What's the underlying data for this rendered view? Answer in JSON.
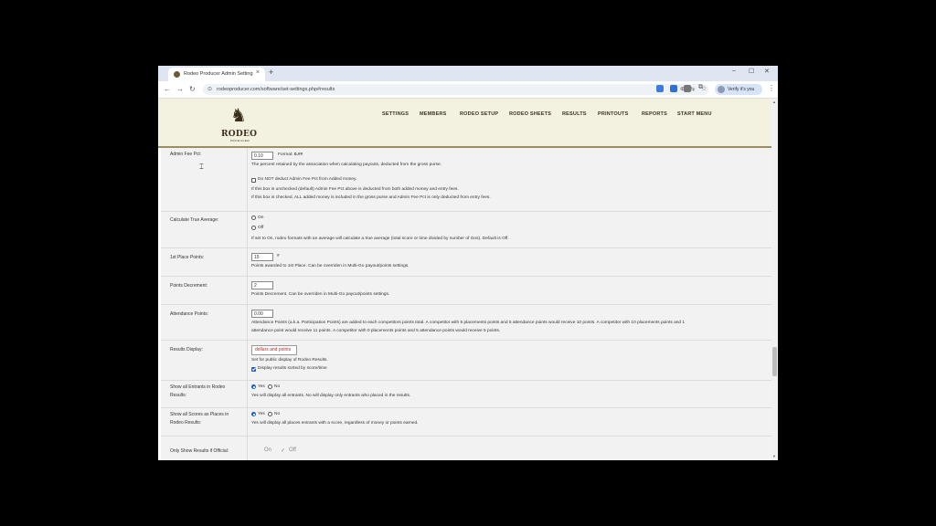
{
  "browser": {
    "tab_title": "Rodeo Producer Admin Setting",
    "url": "rodeoproducer.com/software/set-settings.php#results",
    "verify_label": "Verify it's you",
    "icons": [
      "back-icon",
      "forward-icon",
      "reload-icon",
      "zoom-icon",
      "translate-icon",
      "star-icon",
      "extensions-icon",
      "menu-icon"
    ]
  },
  "site": {
    "logo_text": "RODEO",
    "logo_sub": "PRODUCER",
    "nav": [
      "SETTINGS",
      "MEMBERS",
      "RODEO SETUP",
      "RODEO SHEETS",
      "RESULTS",
      "PRINTOUTS",
      "REPORTS",
      "START MENU"
    ]
  },
  "settings": {
    "admin_fee": {
      "label": "Admin Fee Pct:",
      "value": "0.10",
      "format_label": "Format:",
      "format_value": "0.##",
      "desc": "The percent retained by the association when calculating payouts, deducted from the gross purse.",
      "checkbox_label": "Do NOT deduct Admin Fee Pct from Added money.",
      "note1": "If this box is unchecked (default) Admin Fee Pct above is deducted from both added money and entry fees.",
      "note2": "If this box is checked, ALL added money is included in the gross purse and Admin Fee Pct is only deducted from entry fees."
    },
    "true_average": {
      "label": "Calculate True Average:",
      "on": "On",
      "off": "Off",
      "desc": "If set to On, rodeo formats with an average will calculate a true average (total score or time divided by number of Gos). Default is Off."
    },
    "first_place": {
      "label": "1st Place Points:",
      "value": "15",
      "suffix": "#",
      "desc": "Points awarded to 1st Place. Can be overriden in Multi-Go payout/points settings."
    },
    "points_decrement": {
      "label": "Points Decrement:",
      "value": "2",
      "desc": "Points Decrement. Can be overriden in Multi-Go payout/points settings."
    },
    "attendance": {
      "label": "Attendance Points:",
      "value": "0.00",
      "desc1": "Attendance Points (a.k.a. Participation Points) are added to each competitors points total. A competitor with 5 placements points and 5 attendance points would receive 10 points. A competitor with 10 placements points and 1",
      "desc2": "attendance point would receive 11 points. A competitor with 0 placements points and 5 attendance points would receive 5 points."
    },
    "results_display": {
      "label": "Results Display:",
      "selected": "dollars and points",
      "desc": "Set for public display of Rodeo Results.",
      "sort_label": "Display results sorted by score/time"
    },
    "show_all_entrants": {
      "label1": "Show all Entrants in Rodeo",
      "label2": "Results:",
      "yes": "Yes",
      "no": "No",
      "desc": "Yes will display all entrants. No will display only entrants who placed in the results."
    },
    "show_all_scores": {
      "label1": "Show all Scores as Places in",
      "label2": "Rodeo Results:",
      "yes": "Yes",
      "no": "No",
      "desc": "Yes will display all places entrants with a score, regardless of money or points earned."
    },
    "official": {
      "label": "Only Show Results if Official:",
      "on": "On",
      "off": "Off"
    }
  }
}
